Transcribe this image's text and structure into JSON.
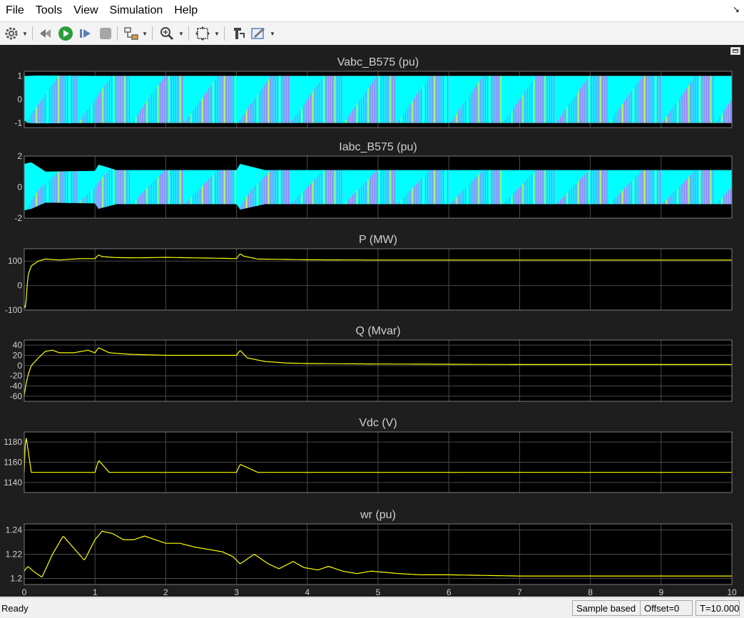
{
  "menubar": {
    "items": [
      "File",
      "Tools",
      "View",
      "Simulation",
      "Help"
    ]
  },
  "toolbar": {
    "icons": [
      "gear-icon",
      "rewind-icon",
      "run-icon",
      "step-forward-icon",
      "stop-icon",
      "highlight-model-icon",
      "zoom-icon",
      "autoscale-icon",
      "pan-icon",
      "style-icon"
    ]
  },
  "colors": {
    "scope_background": "#1e1e1e",
    "axes_background": "#000000",
    "grid": "#4a4a4a",
    "text": "#d0d0d0",
    "phase_a": "#ffff00",
    "phase_b": "#ff40ff",
    "phase_c": "#00ffff"
  },
  "chart_data": [
    {
      "type": "line",
      "title": "Vabc_B575 (pu)",
      "xlim": [
        0,
        10
      ],
      "ylim": [
        -1.2,
        1.2
      ],
      "yticks": [
        -1,
        0,
        1
      ],
      "grid": true,
      "series": [
        {
          "color": "#00ffff",
          "x": [
            0,
            0.05,
            0.2,
            1,
            3,
            10
          ],
          "upper": [
            1.0,
            1.0,
            1.02,
            1.0,
            1.0,
            1.0
          ],
          "lower": [
            -0.9,
            -1.0,
            -1.02,
            -1.0,
            -1.0,
            -1.0
          ]
        }
      ]
    },
    {
      "type": "line",
      "title": "Iabc_B575 (pu)",
      "xlim": [
        0,
        10
      ],
      "ylim": [
        -2,
        2
      ],
      "yticks": [
        -2,
        0,
        2
      ],
      "grid": true,
      "series": [
        {
          "color": "#00ffff",
          "x": [
            0,
            0.1,
            0.3,
            1,
            1.05,
            1.3,
            3,
            3.05,
            3.4,
            10
          ],
          "upper": [
            1.5,
            1.6,
            1.0,
            1.05,
            1.45,
            1.1,
            1.1,
            1.5,
            1.1,
            1.1
          ],
          "lower": [
            -1.5,
            -1.4,
            -1.0,
            -1.05,
            -1.4,
            -1.1,
            -1.1,
            -1.45,
            -1.1,
            -1.1
          ]
        }
      ]
    },
    {
      "type": "line",
      "title": "P (MW)",
      "xlim": [
        0,
        10
      ],
      "ylim": [
        -100,
        150
      ],
      "yticks": [
        -100,
        0,
        100
      ],
      "grid": true,
      "series": [
        {
          "color": "#ffff00",
          "x": [
            0,
            0.02,
            0.05,
            0.1,
            0.2,
            0.3,
            0.5,
            0.8,
            1.0,
            1.05,
            1.1,
            1.3,
            1.6,
            2,
            3,
            3.05,
            3.1,
            3.3,
            3.6,
            4,
            5,
            10
          ],
          "y": [
            -80,
            -95,
            40,
            80,
            100,
            108,
            104,
            110,
            110,
            125,
            118,
            114,
            113,
            115,
            110,
            130,
            120,
            108,
            107,
            105,
            104,
            104
          ]
        }
      ]
    },
    {
      "type": "line",
      "title": "Q (Mvar)",
      "xlim": [
        0,
        10
      ],
      "ylim": [
        -70,
        50
      ],
      "yticks": [
        -60,
        -40,
        -20,
        0,
        20,
        40
      ],
      "grid": true,
      "series": [
        {
          "color": "#ffff00",
          "x": [
            0,
            0.02,
            0.05,
            0.1,
            0.2,
            0.3,
            0.4,
            0.5,
            0.7,
            0.9,
            1.0,
            1.05,
            1.2,
            1.5,
            2,
            2.5,
            3,
            3.05,
            3.15,
            3.4,
            3.7,
            4,
            5,
            7,
            10
          ],
          "y": [
            -60,
            -40,
            -20,
            0,
            15,
            28,
            30,
            25,
            25,
            30,
            25,
            35,
            25,
            22,
            20,
            20,
            20,
            30,
            15,
            8,
            5,
            4,
            3,
            2,
            2
          ]
        }
      ]
    },
    {
      "type": "line",
      "title": "Vdc (V)",
      "xlim": [
        0,
        10
      ],
      "ylim": [
        1130,
        1190
      ],
      "yticks": [
        1140,
        1160,
        1180
      ],
      "grid": true,
      "series": [
        {
          "color": "#ffff00",
          "x": [
            0,
            0.02,
            0.1,
            0.3,
            0.5,
            1.0,
            1.05,
            1.2,
            1.5,
            3.0,
            3.05,
            3.3,
            3.6,
            10
          ],
          "y": [
            1150,
            1188,
            1150,
            1150,
            1150,
            1150,
            1162,
            1150,
            1150,
            1150,
            1158,
            1150,
            1150,
            1150
          ]
        }
      ]
    },
    {
      "type": "line",
      "title": "wr (pu)",
      "xlim": [
        0,
        10
      ],
      "ylim": [
        1.195,
        1.245
      ],
      "yticks": [
        1.2,
        1.22,
        1.24
      ],
      "grid": true,
      "xticks": [
        0,
        1,
        2,
        3,
        4,
        5,
        6,
        7,
        8,
        9,
        10
      ],
      "series": [
        {
          "color": "#ffff00",
          "x": [
            0,
            0.05,
            0.15,
            0.25,
            0.4,
            0.55,
            0.7,
            0.85,
            1.0,
            1.1,
            1.25,
            1.4,
            1.55,
            1.7,
            1.85,
            2.0,
            2.2,
            2.4,
            2.6,
            2.8,
            2.95,
            3.05,
            3.15,
            3.25,
            3.45,
            3.6,
            3.8,
            3.95,
            4.15,
            4.3,
            4.5,
            4.7,
            4.9,
            5.1,
            5.3,
            5.6,
            6,
            7,
            8,
            10
          ],
          "y": [
            1.206,
            1.21,
            1.205,
            1.201,
            1.22,
            1.235,
            1.225,
            1.215,
            1.232,
            1.239,
            1.237,
            1.232,
            1.232,
            1.235,
            1.232,
            1.229,
            1.229,
            1.226,
            1.224,
            1.222,
            1.218,
            1.212,
            1.216,
            1.22,
            1.212,
            1.208,
            1.214,
            1.209,
            1.207,
            1.21,
            1.206,
            1.204,
            1.206,
            1.205,
            1.204,
            1.203,
            1.203,
            1.202,
            1.202,
            1.202
          ]
        }
      ]
    }
  ],
  "status": {
    "ready": "Ready",
    "sample_mode": "Sample based",
    "offset": "Offset=0",
    "time": "T=10.000"
  }
}
